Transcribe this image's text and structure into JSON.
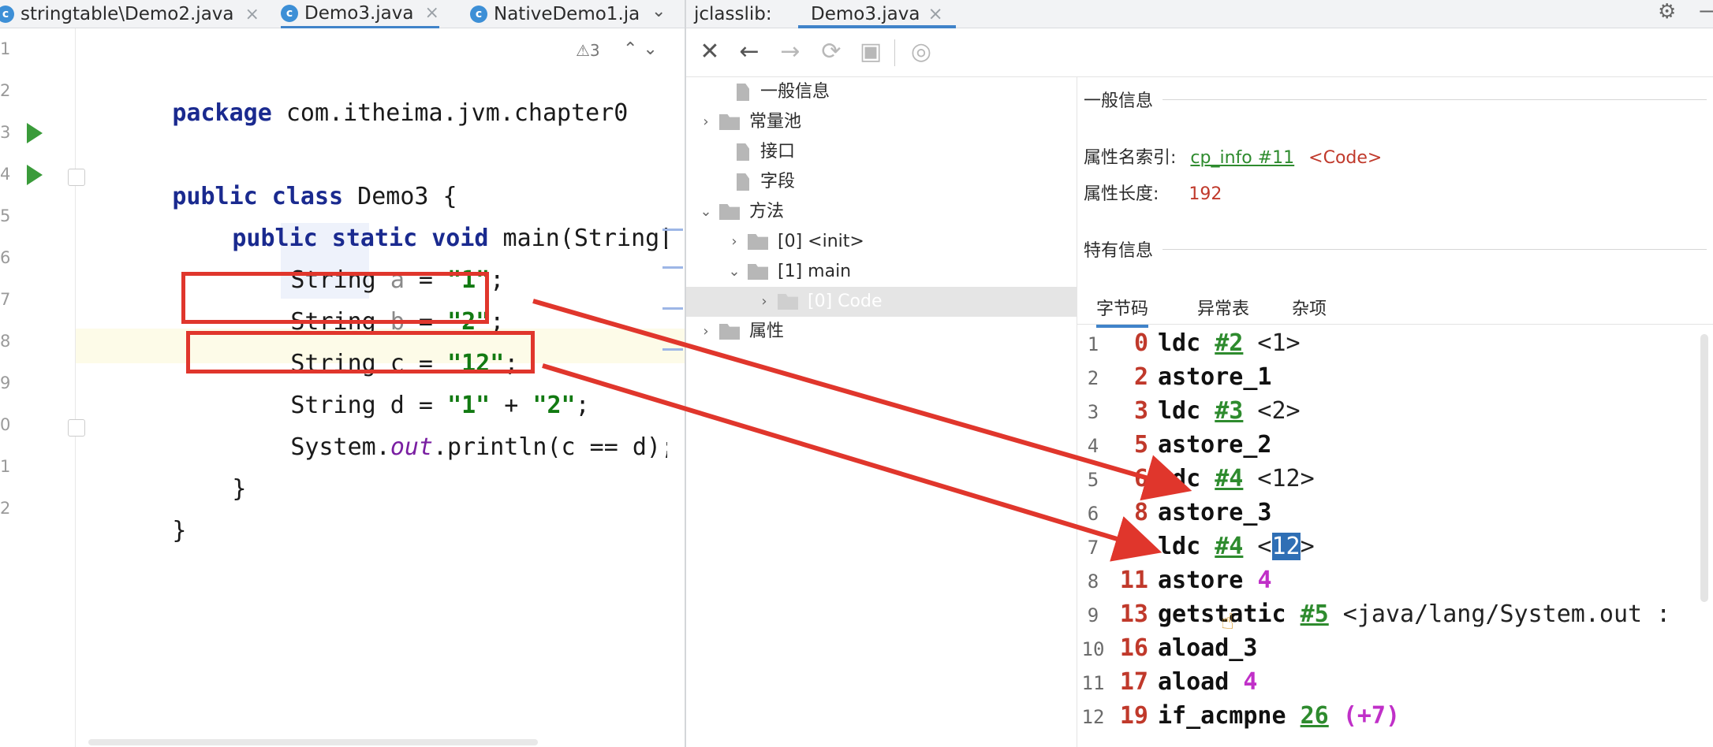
{
  "editor": {
    "tabs": [
      {
        "label": "stringtable\\Demo2.java",
        "icon": "java-class-icon"
      },
      {
        "label": "Demo3.java",
        "icon": "java-class-icon"
      },
      {
        "label": "NativeDemo1.ja",
        "icon": "java-class-icon"
      }
    ],
    "close_glyph": "×",
    "overflow_glyph": "⌄",
    "line_numbers": [
      "1",
      "2",
      "3",
      "4",
      "5",
      "6",
      "7",
      "8",
      "9",
      "0",
      "1",
      "2"
    ],
    "warning_count": "⚠3",
    "lines": {
      "l1_kw": "package",
      "l1_rest": " com.itheima.jvm.chapter0",
      "l3_kw": "public class",
      "l3_rest": " Demo3 {",
      "l4_kw": "public static void",
      "l4_rest": " main(String[] arg",
      "l5_type": "String ",
      "l5_var": "a",
      "l5_eq": " = ",
      "l5_str": "\"1\"",
      "l5_end": ";",
      "l6_type": "String ",
      "l6_var": "b",
      "l6_eq": " = ",
      "l6_str": "\"2\"",
      "l6_end": ";",
      "l7_pre": "String c = ",
      "l7_str": "\"12\"",
      "l7_end": ";",
      "l8_pre": "String d = ",
      "l8_str1": "\"1\"",
      "l8_plus": " + ",
      "l8_str2": "\"2\"",
      "l8_end": ";",
      "l9_pre": "System.",
      "l9_fld": "out",
      "l9_rest": ".println(c == d);",
      "l10": "}",
      "l11": "}"
    }
  },
  "jclasslib": {
    "label": "jclasslib:",
    "tab": "Demo3.java",
    "toolbar": [
      "close-icon",
      "back-icon",
      "forward-icon",
      "refresh-icon",
      "save-icon",
      "web-icon"
    ],
    "tree": [
      {
        "label": "一般信息",
        "kind": "doc"
      },
      {
        "label": "常量池",
        "kind": "folder"
      },
      {
        "label": "接口",
        "kind": "doc"
      },
      {
        "label": "字段",
        "kind": "doc"
      },
      {
        "label": "方法",
        "kind": "folder"
      },
      {
        "label": "[0] <init>",
        "kind": "folder"
      },
      {
        "label": "[1] main",
        "kind": "folder"
      },
      {
        "label": "[0] Code",
        "kind": "folder",
        "selected": true
      },
      {
        "label": "属性",
        "kind": "folder"
      }
    ],
    "general": {
      "title": "一般信息",
      "attr_name_label": "属性名索引:",
      "attr_name_ref": "cp_info #11",
      "attr_name_val": "<Code>",
      "attr_len_label": "属性长度:",
      "attr_len_val": "192"
    },
    "specific_title": "特有信息",
    "subtabs": [
      "字节码",
      "异常表",
      "杂项"
    ],
    "bytecode": [
      {
        "no": "1",
        "off": "0",
        "op": "ldc",
        "ref": "#2",
        "cm": " <1>"
      },
      {
        "no": "2",
        "off": "2",
        "op": "astore_1"
      },
      {
        "no": "3",
        "off": "3",
        "op": "ldc",
        "ref": "#3",
        "cm": " <2>"
      },
      {
        "no": "4",
        "off": "5",
        "op": "astore_2"
      },
      {
        "no": "5",
        "off": "6",
        "op": "ldc",
        "ref": "#4",
        "cm": " <12>"
      },
      {
        "no": "6",
        "off": "8",
        "op": "astore_3"
      },
      {
        "no": "7",
        "off": "9",
        "op": "ldc",
        "ref": "#4",
        "cm_pre": " <",
        "cm_sel": "12",
        "cm_post": ">"
      },
      {
        "no": "8",
        "off": "11",
        "op": "astore",
        "idx": "4"
      },
      {
        "no": "9",
        "off": "13",
        "op": "getstatic",
        "ref": "#5",
        "cm": " <java/lang/System.out :"
      },
      {
        "no": "10",
        "off": "16",
        "op": "aload_3"
      },
      {
        "no": "11",
        "off": "17",
        "op": "aload",
        "idx": "4"
      },
      {
        "no": "12",
        "off": "19",
        "op": "if_acmpne",
        "ref": "26",
        "idx": "(+7)"
      }
    ]
  },
  "colors": {
    "annotation_red": "#e0362c",
    "accent_blue": "#4083c9"
  }
}
